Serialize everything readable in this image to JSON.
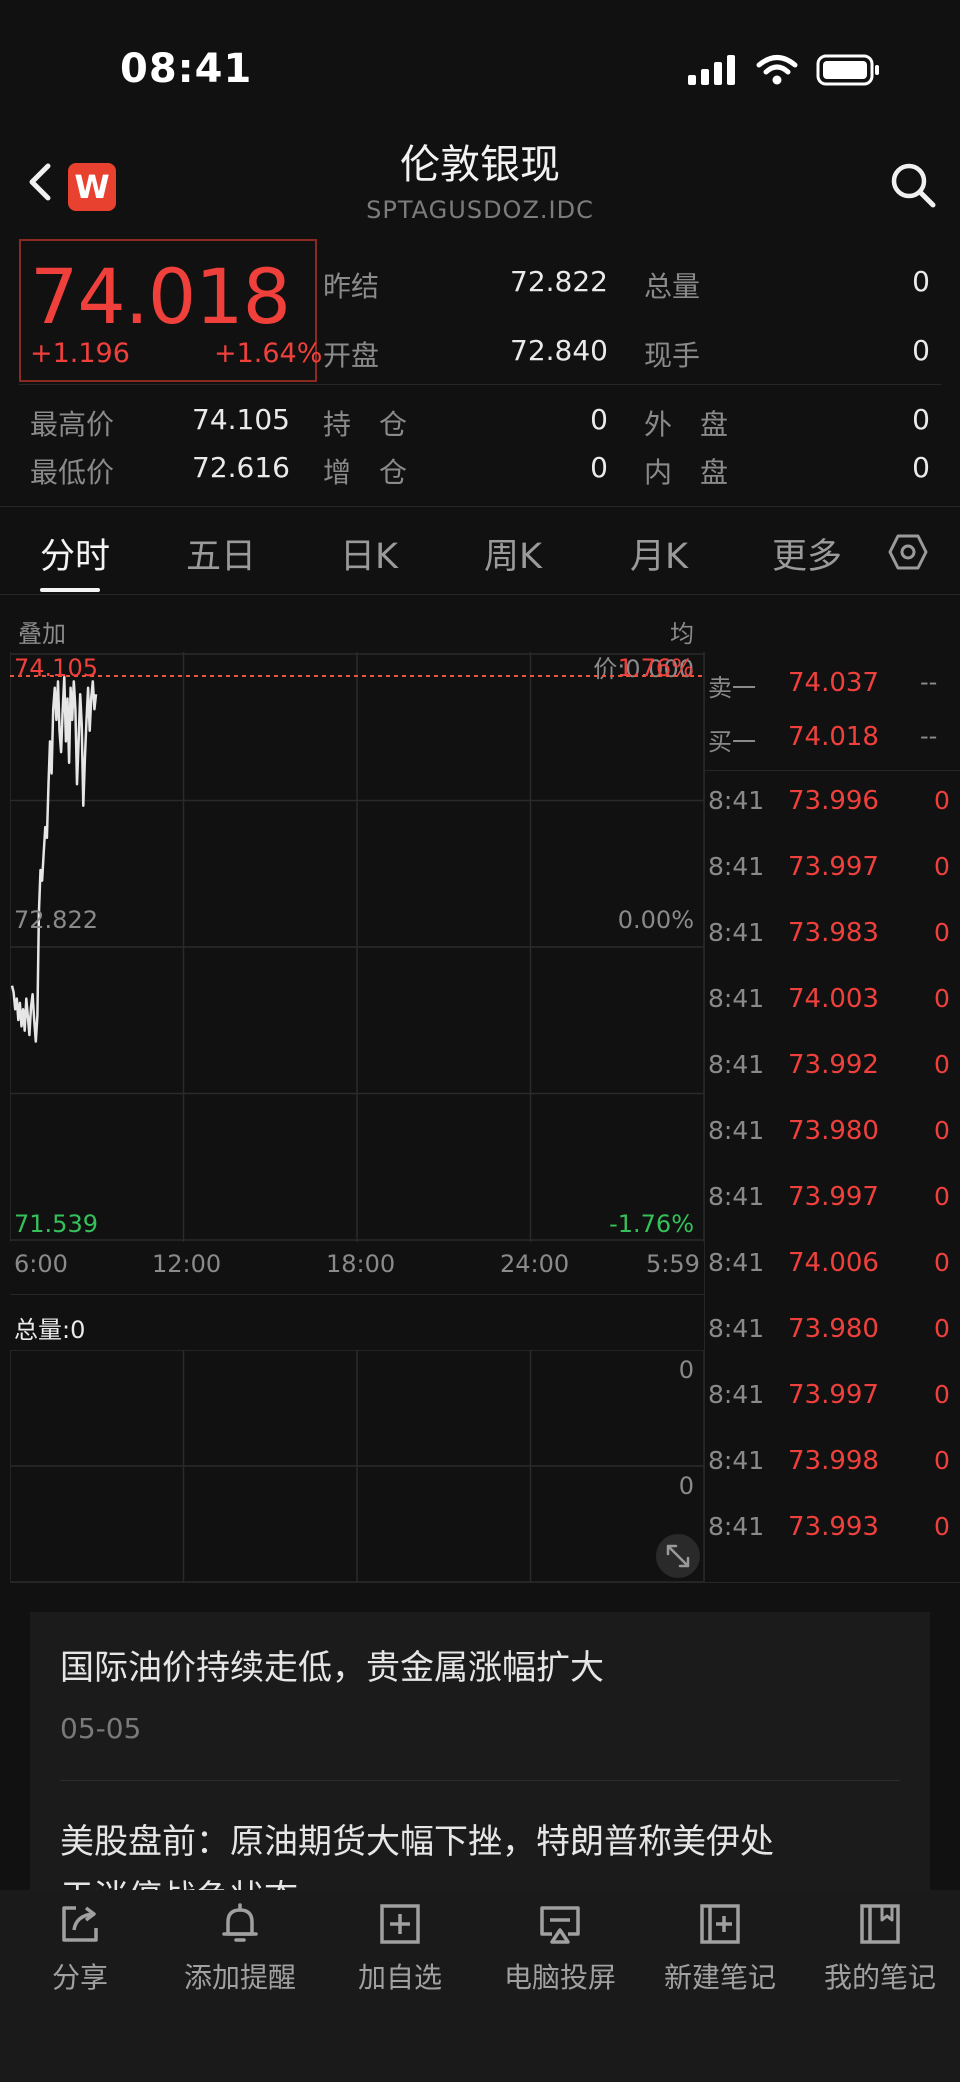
{
  "status": {
    "time": "08:41"
  },
  "header": {
    "logo_letter": "W",
    "title": "伦敦银现",
    "subtitle": "SPTAGUSDOZ.IDC"
  },
  "quote": {
    "price": "74.018",
    "change": "+1.196",
    "change_pct": "+1.64%",
    "stats": [
      {
        "label": "昨结",
        "value": "72.822"
      },
      {
        "label": "总量",
        "value": "0"
      },
      {
        "label": "开盘",
        "value": "72.840"
      },
      {
        "label": "现手",
        "value": "0"
      },
      {
        "label": "最高价",
        "value": "74.105"
      },
      {
        "label": "持　仓",
        "value": "0"
      },
      {
        "label": "外　盘",
        "value": "0"
      },
      {
        "label": "最低价",
        "value": "72.616"
      },
      {
        "label": "增　仓",
        "value": "0"
      },
      {
        "label": "内　盘",
        "value": "0"
      }
    ]
  },
  "tabs": [
    {
      "label": "分时"
    },
    {
      "label": "五日"
    },
    {
      "label": "日K"
    },
    {
      "label": "周K"
    },
    {
      "label": "月K"
    },
    {
      "label": "更多"
    }
  ],
  "chart_header": {
    "overlay": "叠加",
    "avg_price": "均价:0.000"
  },
  "chart_data": {
    "type": "line",
    "y_labels": {
      "top": "74.105",
      "mid": "72.822",
      "bottom": "71.539"
    },
    "pct_labels": {
      "top": "1.76%",
      "mid": "0.00%",
      "bottom": "-1.76%"
    },
    "x_ticks": [
      "6:00",
      "12:00",
      "18:00",
      "24:00",
      "5:59"
    ],
    "ylim": [
      71.539,
      74.105
    ],
    "reference": 72.822,
    "series": [
      {
        "values": [
          72.66,
          72.63,
          72.55,
          72.6,
          72.5,
          72.58,
          72.47,
          72.55,
          72.45,
          72.6,
          72.52,
          72.43,
          72.56,
          72.62,
          72.5,
          72.4,
          72.52,
          73.0,
          73.2,
          73.15,
          73.28,
          73.4,
          73.35,
          73.6,
          73.8,
          73.65,
          73.95,
          74.05,
          73.9,
          74.08,
          73.85,
          73.75,
          73.95,
          74.1,
          73.8,
          74.0,
          73.7,
          74.05,
          73.9,
          74.08,
          73.95,
          73.6,
          73.8,
          74.02,
          73.88,
          73.5,
          73.72,
          73.9,
          74.05,
          73.85,
          74.0,
          74.08,
          73.95,
          74.02
        ]
      }
    ],
    "volume_label": "总量:0",
    "volume_ticks": [
      "0",
      "0"
    ]
  },
  "order_book": {
    "sell": {
      "label": "卖一",
      "price": "74.037",
      "vol": "--"
    },
    "buy": {
      "label": "买一",
      "price": "74.018",
      "vol": "--"
    },
    "trades": [
      {
        "time": "8:41",
        "price": "73.996",
        "vol": "0"
      },
      {
        "time": "8:41",
        "price": "73.997",
        "vol": "0"
      },
      {
        "time": "8:41",
        "price": "73.983",
        "vol": "0"
      },
      {
        "time": "8:41",
        "price": "74.003",
        "vol": "0"
      },
      {
        "time": "8:41",
        "price": "73.992",
        "vol": "0"
      },
      {
        "time": "8:41",
        "price": "73.980",
        "vol": "0"
      },
      {
        "time": "8:41",
        "price": "73.997",
        "vol": "0"
      },
      {
        "time": "8:41",
        "price": "74.006",
        "vol": "0"
      },
      {
        "time": "8:41",
        "price": "73.980",
        "vol": "0"
      },
      {
        "time": "8:41",
        "price": "73.997",
        "vol": "0"
      },
      {
        "time": "8:41",
        "price": "73.998",
        "vol": "0"
      },
      {
        "time": "8:41",
        "price": "73.993",
        "vol": "0"
      }
    ]
  },
  "news": [
    {
      "title": "国际油价持续走低，贵金属涨幅扩大",
      "date": "05-05"
    },
    {
      "title": "美股盘前：原油期货大幅下挫，特朗普称美伊处",
      "title_line2": "于消停战争状态"
    }
  ],
  "bottom_bar": [
    {
      "label": "分享",
      "icon": "share-icon"
    },
    {
      "label": "添加提醒",
      "icon": "bell-icon"
    },
    {
      "label": "加自选",
      "icon": "add-favorite-icon"
    },
    {
      "label": "电脑投屏",
      "icon": "cast-screen-icon"
    },
    {
      "label": "新建笔记",
      "icon": "new-note-icon"
    },
    {
      "label": "我的笔记",
      "icon": "my-notes-icon"
    }
  ],
  "colors": {
    "up": "#f0403c",
    "down": "#35c15a",
    "line": "#e6e6e6",
    "grid": "#2a2a2a"
  }
}
